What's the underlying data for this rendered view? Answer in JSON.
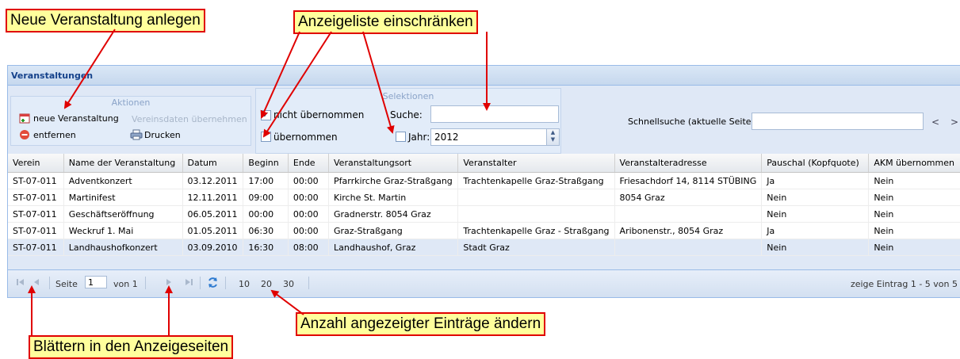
{
  "callouts": {
    "new_event": "Neue Veranstaltung anlegen",
    "filter_list": "Anzeigeliste einschränken",
    "page_size": "Anzahl angezeigter Einträge ändern",
    "paging": "Blättern in den Anzeigeseiten"
  },
  "panel": {
    "title": "Veranstaltungen"
  },
  "actions": {
    "title": "Aktionen",
    "new_event": "neue Veranstaltung",
    "club_data": "Vereinsdaten übernehmen",
    "remove": "entfernen",
    "print": "Drucken"
  },
  "selections": {
    "title": "Selektionen",
    "not_taken": "nicht übernommen",
    "not_taken_checked": true,
    "taken": "übernommen",
    "taken_checked": false,
    "search_label": "Suche:",
    "search_value": "",
    "year_label": "Jahr:",
    "year_checked": false,
    "year_value": "2012"
  },
  "quicksearch": {
    "label": "Schnellsuche (aktuelle Seite)",
    "value": "",
    "prev": "<",
    "next": ">"
  },
  "columns": [
    "Verein",
    "Name der Veranstaltung",
    "Datum",
    "Beginn",
    "Ende",
    "Veranstaltungsort",
    "Veranstalter",
    "Veranstalteradresse",
    "Pauschal (Kopfquote)",
    "AKM übernommen"
  ],
  "rows": [
    [
      "ST-07-011",
      "Adventkonzert",
      "03.12.2011",
      "17:00",
      "00:00",
      "Pfarrkirche Graz-Straßgang",
      "Trachtenkapelle Graz-Straßgang",
      "Friesachdorf 14, 8114 STÜBING",
      "Ja",
      "Nein"
    ],
    [
      "ST-07-011",
      "Martinifest",
      "12.11.2011",
      "09:00",
      "00:00",
      "Kirche St. Martin",
      "",
      "8054 Graz",
      "Nein",
      "Nein"
    ],
    [
      "ST-07-011",
      "Geschäftseröffnung",
      "06.05.2011",
      "00:00",
      "00:00",
      "Gradnerstr. 8054 Graz",
      "",
      "",
      "Nein",
      "Nein"
    ],
    [
      "ST-07-011",
      "Weckruf 1. Mai",
      "01.05.2011",
      "06:30",
      "00:00",
      "Graz-Straßgang",
      "Trachtenkapelle Graz - Straßgang",
      "Aribonenstr., 8054 Graz",
      "Ja",
      "Nein"
    ],
    [
      "ST-07-011",
      "Landhaushofkonzert",
      "03.09.2010",
      "16:30",
      "08:00",
      "Landhaushof, Graz",
      "Stadt Graz",
      "",
      "Nein",
      "Nein"
    ]
  ],
  "selected_row": 4,
  "pager": {
    "page_label": "Seite",
    "page_value": "1",
    "of_label": "von 1",
    "sizes": [
      "10",
      "20",
      "30"
    ],
    "info": "zeige Eintrag 1 - 5 von 5"
  },
  "colors": {
    "accent": "#15428b",
    "callout_border": "#e00000",
    "callout_fill": "#ffff9c"
  }
}
